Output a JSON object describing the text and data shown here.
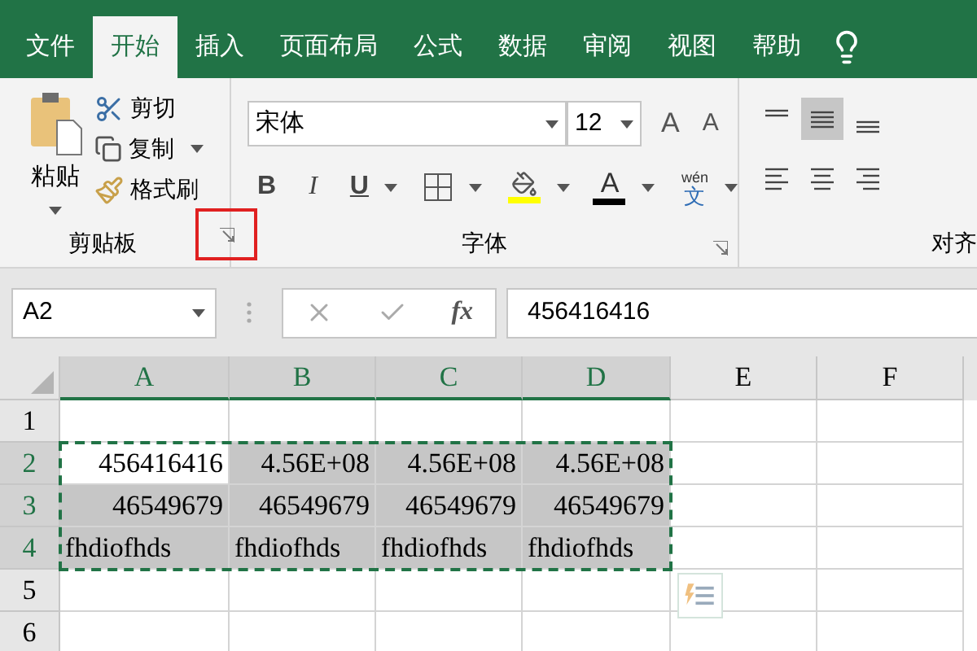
{
  "tabs": [
    {
      "label": "文件",
      "selected": false
    },
    {
      "label": "开始",
      "selected": true
    },
    {
      "label": "插入",
      "selected": false
    },
    {
      "label": "页面布局",
      "selected": false
    },
    {
      "label": "公式",
      "selected": false
    },
    {
      "label": "数据",
      "selected": false
    },
    {
      "label": "审阅",
      "selected": false
    },
    {
      "label": "视图",
      "selected": false
    },
    {
      "label": "帮助",
      "selected": false
    }
  ],
  "clipboard": {
    "paste": "粘贴",
    "cut": "剪切",
    "copy": "复制",
    "format_painter": "格式刷",
    "label": "剪贴板",
    "launcher_highlighted": true
  },
  "font": {
    "font_name": "宋体",
    "font_size": "12",
    "grow": "A",
    "shrink": "A",
    "bold": "B",
    "italic": "I",
    "underline": "U",
    "font_color": "A",
    "pinyin": "wén",
    "pinyin_char": "文",
    "label": "字体"
  },
  "alignment": {
    "label": "对齐"
  },
  "formula_bar": {
    "name_box": "A2",
    "fx": "fx",
    "value": "456416416"
  },
  "grid": {
    "columns": [
      {
        "label": "A",
        "selected": true
      },
      {
        "label": "B",
        "selected": true
      },
      {
        "label": "C",
        "selected": true
      },
      {
        "label": "D",
        "selected": true
      },
      {
        "label": "E",
        "selected": false
      },
      {
        "label": "F",
        "selected": false
      }
    ],
    "rows": [
      {
        "label": "1",
        "selected": false,
        "cells": []
      },
      {
        "label": "2",
        "selected": true,
        "cells": [
          {
            "value": "456416416",
            "kind": "number",
            "active": true
          },
          {
            "value": "4.56E+08",
            "kind": "number",
            "active": false
          },
          {
            "value": "4.56E+08",
            "kind": "number",
            "active": false
          },
          {
            "value": "4.56E+08",
            "kind": "number",
            "active": false
          }
        ]
      },
      {
        "label": "3",
        "selected": true,
        "cells": [
          {
            "value": "46549679",
            "kind": "number",
            "active": false
          },
          {
            "value": "46549679",
            "kind": "number",
            "active": false
          },
          {
            "value": "46549679",
            "kind": "number",
            "active": false
          },
          {
            "value": "46549679",
            "kind": "number",
            "active": false
          }
        ]
      },
      {
        "label": "4",
        "selected": true,
        "cells": [
          {
            "value": "fhdiofhds",
            "kind": "text",
            "active": false
          },
          {
            "value": "fhdiofhds",
            "kind": "text",
            "active": false
          },
          {
            "value": "fhdiofhds",
            "kind": "text",
            "active": false
          },
          {
            "value": "fhdiofhds",
            "kind": "text",
            "active": false
          }
        ]
      },
      {
        "label": "5",
        "selected": false,
        "cells": []
      },
      {
        "label": "6",
        "selected": false,
        "cells": []
      }
    ],
    "copy_marquee": true,
    "paste_options": true
  }
}
